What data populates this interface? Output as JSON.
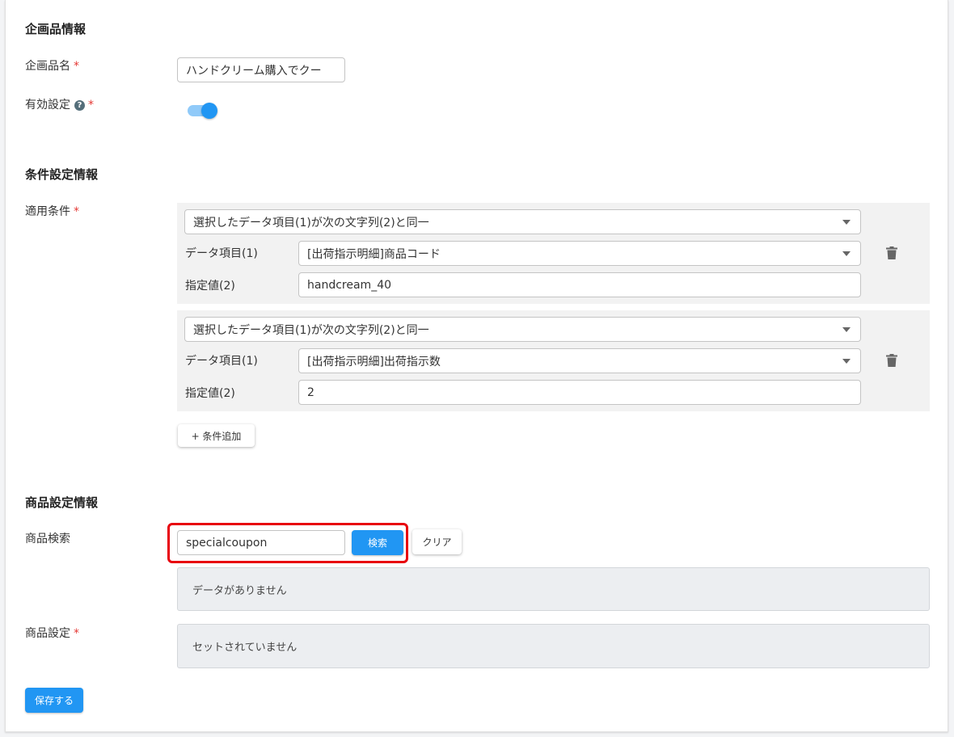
{
  "plan_info": {
    "title": "企画品情報",
    "name_label": "企画品名",
    "name_value": "ハンドクリーム購入でクー",
    "enabled_label": "有効設定",
    "enabled": true
  },
  "condition_info": {
    "title": "条件設定情報",
    "label": "適用条件",
    "field_label": "データ項目(1)",
    "value_label": "指定値(2)",
    "conditions": [
      {
        "operator": "選択したデータ項目(1)が次の文字列(2)と同一",
        "field": "[出荷指示明細]商品コード",
        "value": "handcream_40"
      },
      {
        "operator": "選択したデータ項目(1)が次の文字列(2)と同一",
        "field": "[出荷指示明細]出荷指示数",
        "value": "2"
      }
    ],
    "add_button": "+ 条件追加"
  },
  "product_info": {
    "title": "商品設定情報",
    "search_label": "商品検索",
    "search_value": "specialcoupon",
    "search_button": "検索",
    "clear_button": "クリア",
    "no_data_text": "データがありません",
    "setting_label": "商品設定",
    "not_set_text": "セットされていません"
  },
  "save_button": "保存する",
  "colors": {
    "accent": "#2196f3",
    "required": "#e53935",
    "highlight": "#e8000d"
  }
}
